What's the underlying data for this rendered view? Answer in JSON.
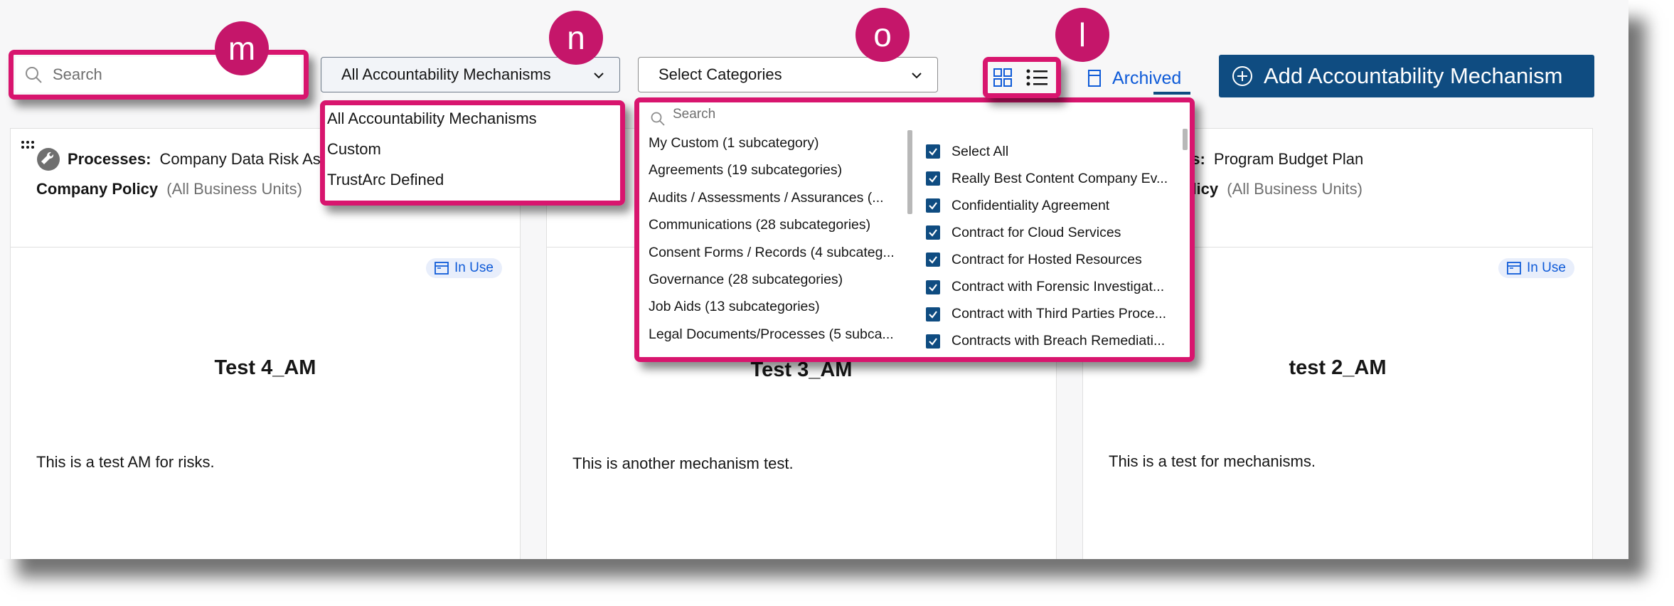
{
  "toolbar": {
    "search_placeholder": "Search",
    "mechanism_filter_value": "All Accountability Mechanisms",
    "category_filter_value": "Select Categories",
    "archived_label": "Archived",
    "add_button_label": "Add Accountability Mechanism"
  },
  "callouts": {
    "search": "m",
    "mechanism_filter": "n",
    "category_filter": "o",
    "view_toggle": "l"
  },
  "mechanism_menu": {
    "items": [
      "All Accountability Mechanisms",
      "Custom",
      "TrustArc Defined"
    ]
  },
  "category_dropdown": {
    "search_placeholder": "Search",
    "categories": [
      "My Custom (1 subcategory)",
      "Agreements (19 subcategories)",
      "Audits / Assessments / Assurances (...",
      "Communications (28 subcategories)",
      "Consent Forms / Records (4 subcateg...",
      "Governance (28 subcategories)",
      "Job Aids (13 subcategories)",
      "Legal Documents/Processes (5 subca..."
    ],
    "subcategories": [
      "Select All",
      "Really Best Content Company Ev...",
      "Confidentiality Agreement",
      "Contract for Cloud Services",
      "Contract for Hosted Resources",
      "Contract with Forensic Investigat...",
      "Contract with Third Parties Proce...",
      "Contracts with Breach Remediati..."
    ]
  },
  "cards": [
    {
      "processes_label": "Processes:",
      "processes_value": "Company Data Risk Asse",
      "policy": "Company Policy",
      "scope": "(All Business Units)",
      "status": "In Use",
      "title": "Test 4_AM",
      "description": "This is a test AM for risks."
    },
    {
      "processes_label": "",
      "processes_value": "",
      "policy": "",
      "scope": "",
      "status": "",
      "title": "Test 3_AM",
      "description": "This is another mechanism test."
    },
    {
      "processes_label": "es:",
      "processes_value": "Program Budget Plan",
      "policy": "olicy",
      "scope": "(All Business Units)",
      "status": "In Use",
      "title": "test 2_AM",
      "description": "This is a test for mechanisms."
    }
  ],
  "colors": {
    "accent": "#d8156e",
    "badge": "#c5166a",
    "primary_button": "#0f4c81",
    "link": "#0f5bd8"
  }
}
